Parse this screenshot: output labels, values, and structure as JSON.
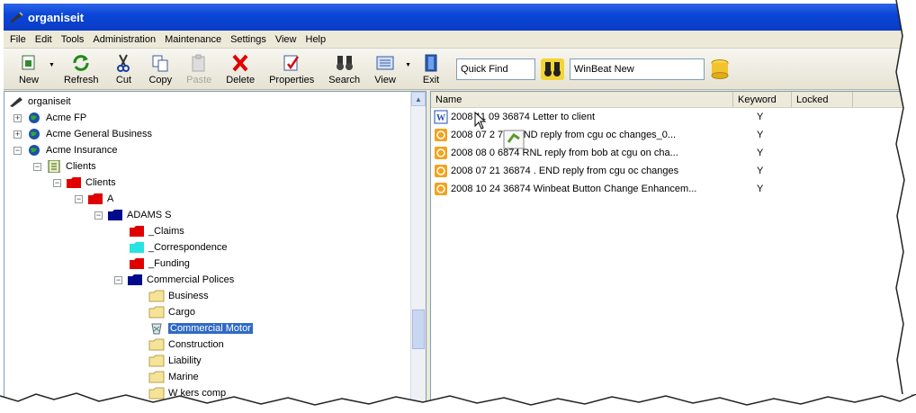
{
  "window": {
    "title": "organiseit"
  },
  "menu": [
    "File",
    "Edit",
    "Tools",
    "Administration",
    "Maintenance",
    "Settings",
    "View",
    "Help"
  ],
  "toolbar": {
    "new": "New",
    "refresh": "Refresh",
    "cut": "Cut",
    "copy": "Copy",
    "paste": "Paste",
    "delete": "Delete",
    "properties": "Properties",
    "search": "Search",
    "view": "View",
    "exit": "Exit",
    "quick_find_value": "Quick Find",
    "winbeat_value": "WinBeat New"
  },
  "tree": {
    "root": "organiseit",
    "acme_fp": "Acme FP",
    "acme_general": "Acme General Business",
    "acme_insurance": "Acme Insurance",
    "clients_1": "Clients",
    "clients_2": "Clients",
    "a": "A",
    "adams": "ADAMS S",
    "claims": "_Claims",
    "correspondence": "_Correspondence",
    "funding": "_Funding",
    "commercial_policies": "Commercial Polices",
    "business": "Business",
    "cargo": "Cargo",
    "commercial_motor": "Commercial Motor",
    "construction": "Construction",
    "liability": "Liability",
    "marine": "Marine",
    "workers": "W  kers comp"
  },
  "list": {
    "columns": {
      "name": "Name",
      "keyword": "Keyword",
      "locked": "Locked"
    },
    "rows": [
      {
        "name": "2008 11 09 36874 Letter to client",
        "keyword": "Y",
        "icon": "word-doc-icon"
      },
      {
        "name": "2008 07 2    74 . END reply from cgu oc changes_0...",
        "keyword": "Y",
        "icon": "email-icon"
      },
      {
        "name": "2008 08 0     6874 RNL reply from bob at cgu on cha...",
        "keyword": "Y",
        "icon": "email-icon"
      },
      {
        "name": "2008 07 21 36874 . END reply from cgu oc changes",
        "keyword": "Y",
        "icon": "email-icon"
      },
      {
        "name": "2008 10 24  36874 Winbeat Button Change Enhancem...",
        "keyword": "Y",
        "icon": "email-icon"
      }
    ]
  },
  "colors": {
    "titlebar": "#0a46d8",
    "selection": "#316ac5",
    "folder_red": "#e00000",
    "folder_navy": "#000a8c",
    "folder_cyan": "#27e3e3",
    "folder_yellow": "#f6e39a"
  }
}
